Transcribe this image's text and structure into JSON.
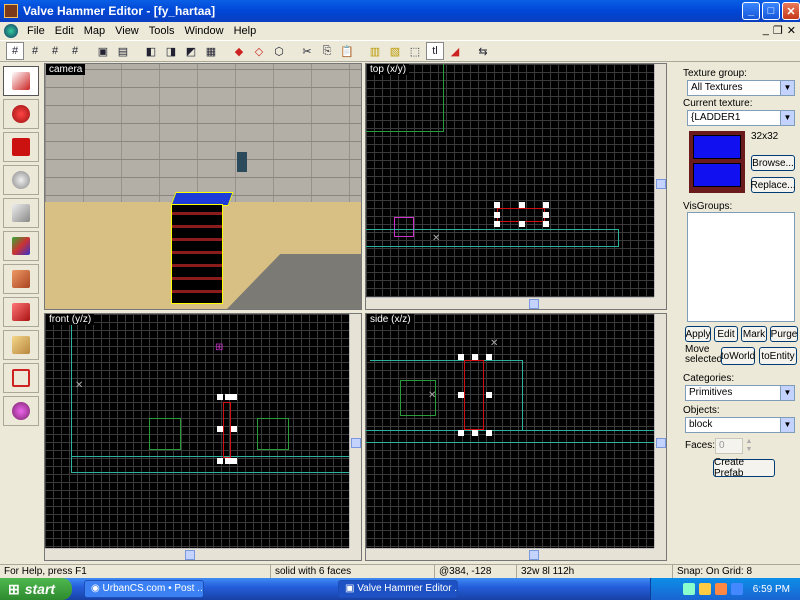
{
  "window": {
    "title": "Valve Hammer Editor - [fy_hartaa]"
  },
  "menu": [
    "File",
    "Edit",
    "Map",
    "View",
    "Tools",
    "Window",
    "Help"
  ],
  "viewports": {
    "camera": "camera",
    "top": "top (x/y)",
    "front": "front (y/z)",
    "side": "side (x/z)"
  },
  "panel": {
    "texture_group_label": "Texture group:",
    "texture_group_value": "All Textures",
    "current_texture_label": "Current texture:",
    "current_texture_value": "{LADDER1",
    "texture_size": "32x32",
    "browse": "Browse...",
    "replace": "Replace...",
    "visgroups_label": "VisGroups:",
    "apply": "Apply",
    "edit": "Edit",
    "mark": "Mark",
    "purge": "Purge",
    "move_selected": "Move selected",
    "to_world": "toWorld",
    "to_entity": "toEntity",
    "categories_label": "Categories:",
    "categories_value": "Primitives",
    "objects_label": "Objects:",
    "objects_value": "block",
    "faces_label": "Faces:",
    "faces_value": "0",
    "create_prefab": "Create Prefab"
  },
  "status": {
    "help": "For Help, press F1",
    "selection": "solid with 6 faces",
    "coords": "@384, -128",
    "size": "32w 8l 112h",
    "snap": "Snap: On Grid: 8"
  },
  "taskbar": {
    "start": "start",
    "task1": "UrbanCS.com • Post ...",
    "task2": "Valve Hammer Editor ...",
    "clock": "6:59 PM"
  },
  "colors": {
    "accent": "#0a5fe6",
    "grid_line": "#3a3a3a",
    "brush_red": "#d01010",
    "selection_handle": "#ffffff"
  }
}
